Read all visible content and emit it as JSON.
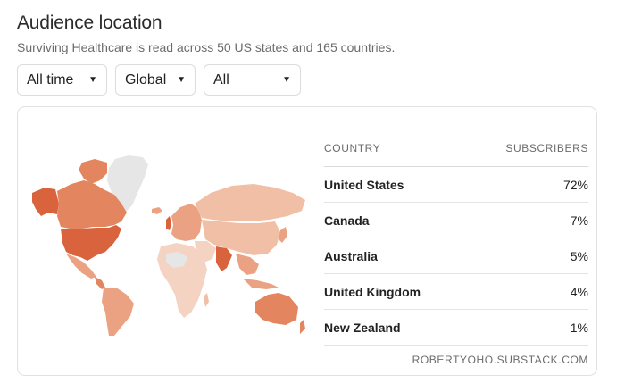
{
  "header": {
    "title": "Audience location",
    "subtitle": "Surviving Healthcare is read across 50 US states and 165 countries."
  },
  "filters": [
    {
      "label": "All time"
    },
    {
      "label": "Global"
    },
    {
      "label": "All"
    }
  ],
  "map": {
    "legend_colors": {
      "highest": "#d9633d",
      "high": "#e3855f",
      "medium": "#eba283",
      "low": "#f1bfa6",
      "lowest": "#f5d3c2",
      "none": "#e6e6e6"
    },
    "highlighted": [
      "United States",
      "Canada",
      "Australia",
      "United Kingdom",
      "New Zealand",
      "India"
    ]
  },
  "table": {
    "headers": {
      "country": "COUNTRY",
      "subscribers": "SUBSCRIBERS"
    },
    "rows": [
      {
        "country": "United States",
        "value": "72%"
      },
      {
        "country": "Canada",
        "value": "7%"
      },
      {
        "country": "Australia",
        "value": "5%"
      },
      {
        "country": "United Kingdom",
        "value": "4%"
      },
      {
        "country": "New Zealand",
        "value": "1%"
      }
    ],
    "footer": "ROBERTYOHO.SUBSTACK.COM"
  }
}
